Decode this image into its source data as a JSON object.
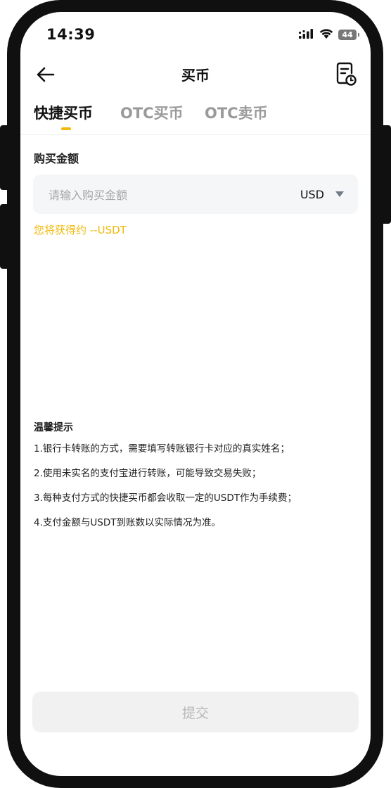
{
  "status_bar": {
    "time": "14:39",
    "battery": "44",
    "icons": [
      "cellular-signal-icon",
      "wifi-icon",
      "battery-icon"
    ]
  },
  "nav": {
    "title": "买币",
    "back_icon": "arrow-left-icon",
    "history_icon": "order-history-icon"
  },
  "tabs": [
    {
      "label": "快捷买币",
      "active": true
    },
    {
      "label": "OTC买币",
      "active": false
    },
    {
      "label": "OTC卖币",
      "active": false
    }
  ],
  "form": {
    "amount_label": "购买金额",
    "amount_placeholder": "请输入购买金额",
    "amount_value": "",
    "currency": "USD",
    "receive_text": "您将获得约 --USDT"
  },
  "tips": {
    "title": "温馨提示",
    "items": [
      "1.银行卡转账的方式，需要填写转账银行卡对应的真实姓名；",
      "2.使用未实名的支付宝进行转账，可能导致交易失败；",
      "3.每种支付方式的快捷买币都会收取一定的USDT作为手续费；",
      "4.支付金额与USDT到账数以实际情况为准。"
    ]
  },
  "submit_label": "提交",
  "colors": {
    "accent": "#f0b90b",
    "text_primary": "#111111",
    "text_inactive": "#9a9a9a",
    "input_bg": "#f5f6f8",
    "button_disabled_bg": "#f1f1f1",
    "button_disabled_text": "#b8b8b8"
  }
}
